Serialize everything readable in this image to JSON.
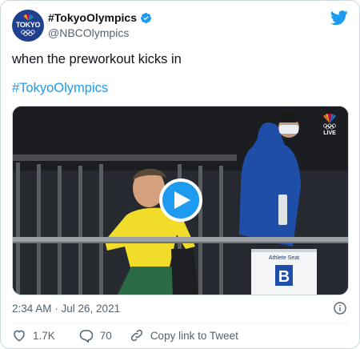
{
  "account": {
    "display_name": "#TokyoOlympics",
    "handle": "@NBCOlympics",
    "avatar_text": "TOKYO",
    "verified": true
  },
  "tweet": {
    "text": "when the preworkout kicks in",
    "hashtag": "#TokyoOlympics"
  },
  "media": {
    "broadcaster_badge": "LIVE",
    "sign_text": "Athlete Seat",
    "sign_letter": "B",
    "play_icon": "play-icon"
  },
  "meta": {
    "timestamp": "2:34 AM · Jul 26, 2021"
  },
  "actions": {
    "likes": "1.7K",
    "replies": "70",
    "copy_link": "Copy link to Tweet"
  },
  "colors": {
    "accent": "#1d9bf0",
    "like": "#536471",
    "text": "#0f1419",
    "muted": "#536471"
  }
}
